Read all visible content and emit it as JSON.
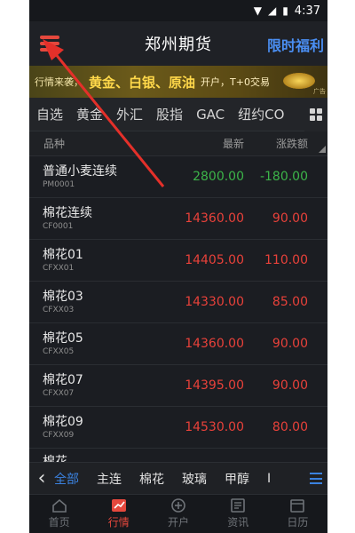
{
  "status_bar": {
    "time": "4:37"
  },
  "header": {
    "title": "郑州期货",
    "promo": "限时福利"
  },
  "banner": {
    "prefix": "行情来袭，",
    "main": "黄金、白银、原油",
    "sub": "开户，T+0交易",
    "ad_tag": "广告"
  },
  "categories": [
    {
      "label": "自选"
    },
    {
      "label": "黄金"
    },
    {
      "label": "外汇"
    },
    {
      "label": "股指"
    },
    {
      "label": "GAC"
    },
    {
      "label": "纽约CO"
    }
  ],
  "table": {
    "headers": {
      "name": "品种",
      "price": "最新",
      "change": "涨跌额"
    },
    "rows": [
      {
        "name": "普通小麦连续",
        "code": "PM0001",
        "price": "2800.00",
        "change": "-180.00",
        "trend": "down"
      },
      {
        "name": "棉花连续",
        "code": "CF0001",
        "price": "14360.00",
        "change": "90.00",
        "trend": "up"
      },
      {
        "name": "棉花01",
        "code": "CFXX01",
        "price": "14405.00",
        "change": "110.00",
        "trend": "up"
      },
      {
        "name": "棉花03",
        "code": "CFXX03",
        "price": "14330.00",
        "change": "85.00",
        "trend": "up"
      },
      {
        "name": "棉花05",
        "code": "CFXX05",
        "price": "14360.00",
        "change": "90.00",
        "trend": "up"
      },
      {
        "name": "棉花07",
        "code": "CFXX07",
        "price": "14395.00",
        "change": "90.00",
        "trend": "up"
      },
      {
        "name": "棉花09",
        "code": "CFXX09",
        "price": "14530.00",
        "change": "80.00",
        "trend": "up"
      }
    ],
    "partial_row": "棉花..."
  },
  "sub_tabs": [
    {
      "label": "全部",
      "active": true
    },
    {
      "label": "主连",
      "active": false
    },
    {
      "label": "棉花",
      "active": false
    },
    {
      "label": "玻璃",
      "active": false
    },
    {
      "label": "甲醇",
      "active": false
    },
    {
      "label": "I",
      "active": false
    }
  ],
  "tab_bar": [
    {
      "label": "首页",
      "icon": "home-icon",
      "active": false
    },
    {
      "label": "行情",
      "icon": "chart-icon",
      "active": true
    },
    {
      "label": "开户",
      "icon": "plus-circle-icon",
      "active": false
    },
    {
      "label": "资讯",
      "icon": "news-icon",
      "active": false
    },
    {
      "label": "日历",
      "icon": "calendar-icon",
      "active": false
    }
  ],
  "colors": {
    "up": "#e8413a",
    "down": "#3cb449",
    "accent": "#e5483d",
    "active_tab": "#3b82e0",
    "promo": "#4a8ef2"
  }
}
